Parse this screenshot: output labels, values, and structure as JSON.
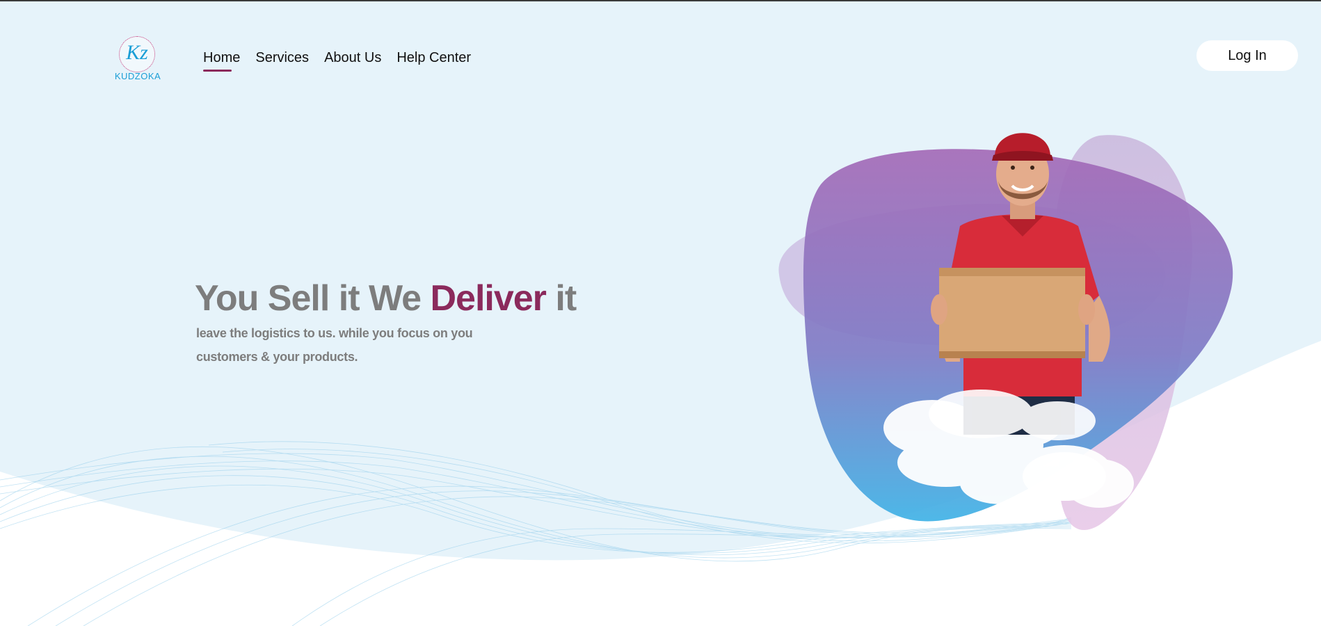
{
  "brand": {
    "logo_monogram": "Kz",
    "logo_name": "KUDZOKA"
  },
  "nav": {
    "items": [
      {
        "label": "Home",
        "active": true
      },
      {
        "label": "Services",
        "active": false
      },
      {
        "label": "About Us",
        "active": false
      },
      {
        "label": "Help Center",
        "active": false
      }
    ]
  },
  "header": {
    "login_label": "Log In"
  },
  "hero": {
    "headline_part1": "You Sell it We ",
    "headline_accent": "Deliver",
    "headline_part2": " it",
    "subtext": "leave the logistics to us. while you focus on you customers & your products."
  },
  "colors": {
    "background": "#e6f3fa",
    "accent": "#8b2a5c",
    "logo_blue": "#1a9ed6",
    "headline_gray": "#7d7d7d"
  },
  "icons": {
    "logo": "kz-monogram-icon",
    "hero_image": "delivery-man-with-box-icon"
  }
}
